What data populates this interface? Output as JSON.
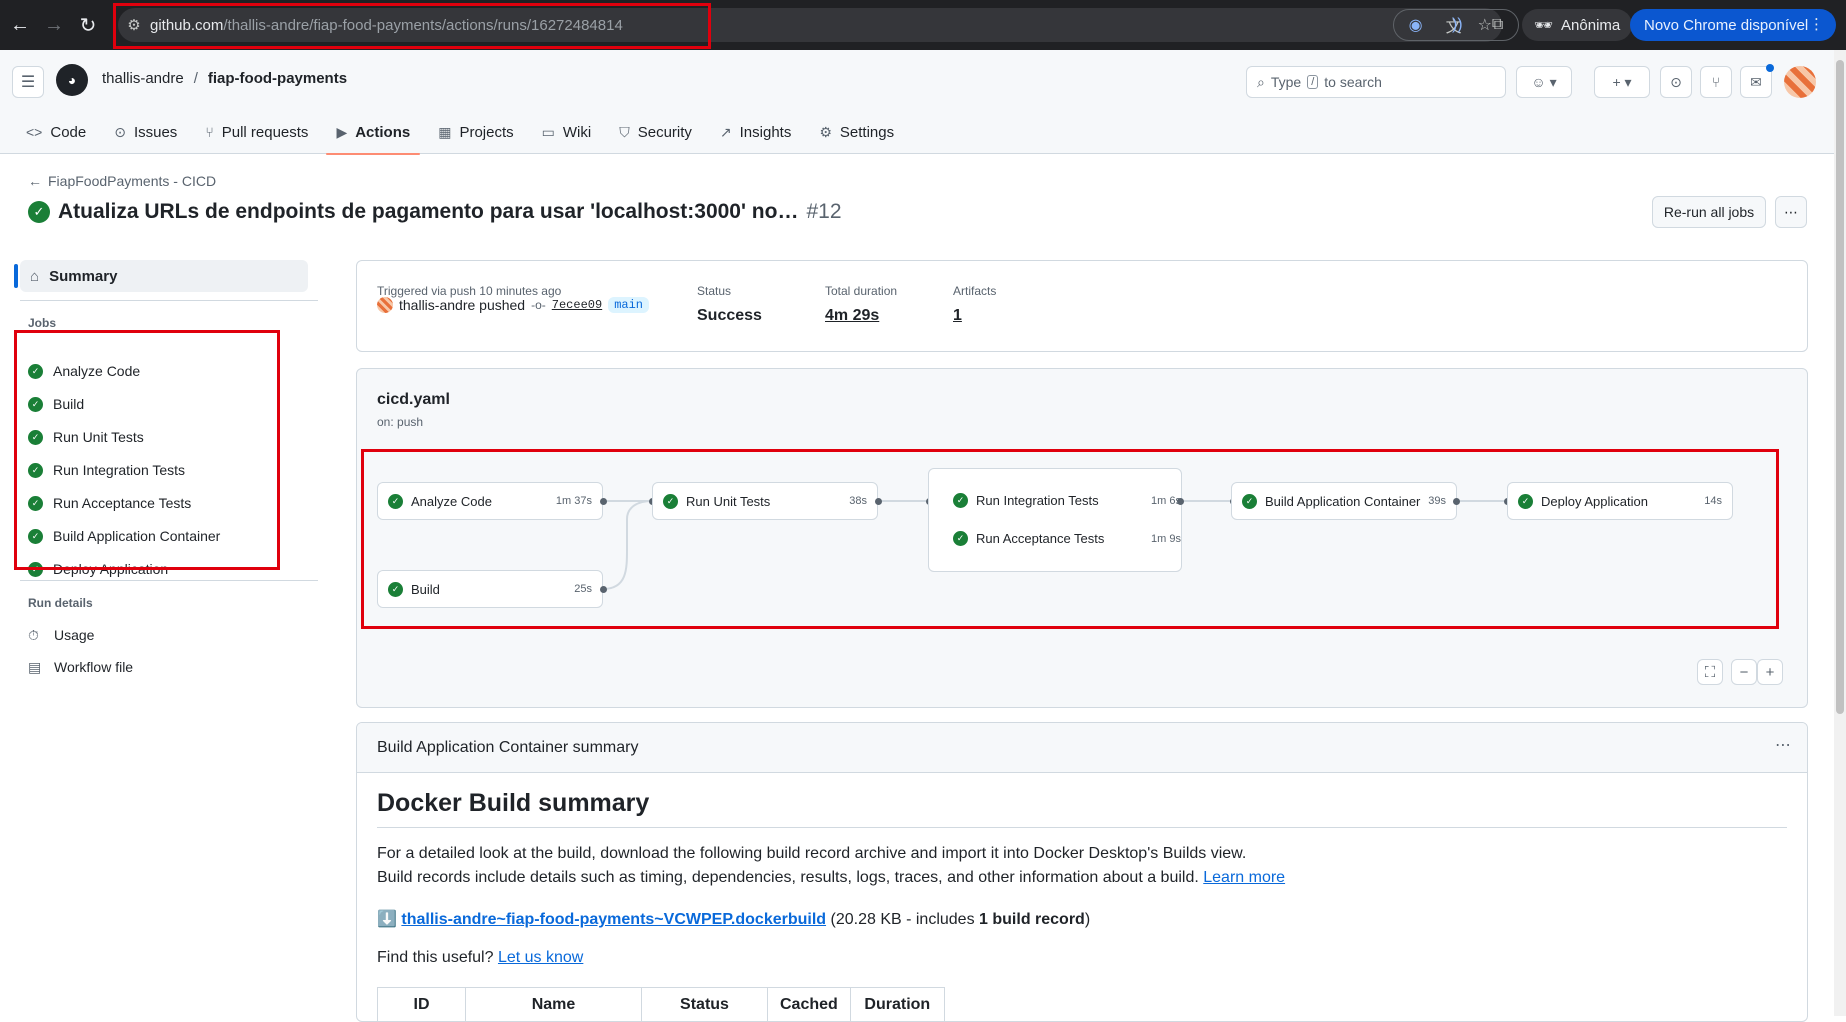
{
  "browser": {
    "url_host": "github.com",
    "url_path": "/thallis-andre/fiap-food-payments/actions/runs/16272484814",
    "incognito_label": "Anônima",
    "update_label": "Novo Chrome disponível"
  },
  "header": {
    "owner": "thallis-andre",
    "separator": "/",
    "repo": "fiap-food-payments",
    "search_prefix": "Type",
    "search_key": "/",
    "search_suffix": "to search"
  },
  "tabs": [
    {
      "label": "Code",
      "icon": "code-icon"
    },
    {
      "label": "Issues",
      "icon": "issue-icon"
    },
    {
      "label": "Pull requests",
      "icon": "pull-request-icon"
    },
    {
      "label": "Actions",
      "icon": "play-icon"
    },
    {
      "label": "Projects",
      "icon": "table-icon"
    },
    {
      "label": "Wiki",
      "icon": "book-icon"
    },
    {
      "label": "Security",
      "icon": "shield-icon"
    },
    {
      "label": "Insights",
      "icon": "graph-icon"
    },
    {
      "label": "Settings",
      "icon": "gear-icon"
    }
  ],
  "run": {
    "back_label": "FiapFoodPayments - CICD",
    "title": "Atualiza URLs de endpoints de pagamento para usar 'localhost:3000' no…",
    "number": "#12",
    "rerun_label": "Re-run all jobs"
  },
  "sidebar": {
    "summary_label": "Summary",
    "jobs_heading": "Jobs",
    "jobs": [
      "Analyze Code",
      "Build",
      "Run Unit Tests",
      "Run Integration Tests",
      "Run Acceptance Tests",
      "Build Application Container",
      "Deploy Application"
    ],
    "details_heading": "Run details",
    "usage_label": "Usage",
    "workflow_file_label": "Workflow file"
  },
  "run_meta": {
    "triggered_label": "Triggered via push 10 minutes ago",
    "actor": "thallis-andre pushed",
    "sha": "7ecee09",
    "branch": "main",
    "status_label": "Status",
    "status_value": "Success",
    "duration_label": "Total duration",
    "duration_value": "4m 29s",
    "artifacts_label": "Artifacts",
    "artifacts_value": "1"
  },
  "workflow": {
    "file": "cicd.yaml",
    "trigger": "on: push",
    "nodes": {
      "analyze": {
        "name": "Analyze Code",
        "duration": "1m 37s"
      },
      "build": {
        "name": "Build",
        "duration": "25s"
      },
      "unit": {
        "name": "Run Unit Tests",
        "duration": "38s"
      },
      "integration": {
        "name": "Run Integration Tests",
        "duration": "1m 6s"
      },
      "acceptance": {
        "name": "Run Acceptance Tests",
        "duration": "1m 9s"
      },
      "container": {
        "name": "Build Application Container",
        "duration": "39s"
      },
      "deploy": {
        "name": "Deploy Application",
        "duration": "14s"
      }
    }
  },
  "summary": {
    "header": "Build Application Container summary",
    "title": "Docker Build summary",
    "p1": "For a detailed look at the build, download the following build record archive and import it into Docker Desktop's Builds view.",
    "p2": "Build records include details such as timing, dependencies, results, logs, traces, and other information about a build.",
    "learn_more": "Learn more",
    "download_icon": "⬇️",
    "record_link": "thallis-andre~fiap-food-payments~VCWPEP.dockerbuild",
    "record_meta_prefix": "(20.28 KB - includes",
    "record_meta_bold": "1 build record",
    "record_meta_suffix": ")",
    "feedback_prefix": "Find this useful?",
    "feedback_link": "Let us know",
    "table_headers": [
      "ID",
      "Name",
      "Status",
      "Cached",
      "Duration"
    ]
  }
}
